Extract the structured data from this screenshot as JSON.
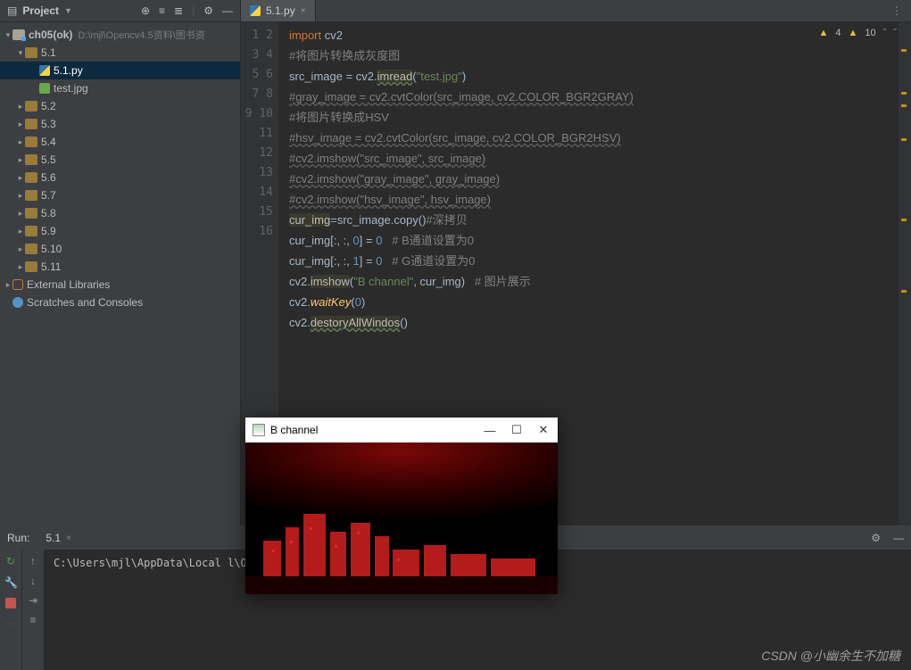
{
  "topbar": {
    "project_label": "Project",
    "icons": [
      "target-icon",
      "collapse-icon",
      "expand-icon",
      "divider",
      "gear-icon",
      "hide-icon"
    ]
  },
  "tab": {
    "label": "5.1.py",
    "close": "×"
  },
  "topmenu": "⋮",
  "tree": {
    "root": {
      "name": "ch05(ok)",
      "path": "D:\\mjl\\Opencv4.5资料\\图书资"
    },
    "folder_open": "5.1",
    "file_py": "5.1.py",
    "file_img": "test.jpg",
    "folders": [
      "5.2",
      "5.3",
      "5.4",
      "5.5",
      "5.6",
      "5.7",
      "5.8",
      "5.9",
      "5.10",
      "5.11"
    ],
    "ext_lib": "External Libraries",
    "scratches": "Scratches and Consoles"
  },
  "warnings": {
    "a": "4",
    "w": "10"
  },
  "code": {
    "l1_kw": "import",
    "l1_mod": " cv2",
    "l2": "#将图片转换成灰度图",
    "l3a": "src_image = cv2.",
    "l3b": "imread",
    "l3c": "(",
    "l3d": "\"test.jpg\"",
    "l3e": ")",
    "l4": "#gray_image = cv2.cvtColor(src_image, cv2.COLOR_BGR2GRAY)",
    "l5": "#将图片转换成HSV",
    "l6": "#hsv_image = cv2.cvtColor(src_image, cv2.COLOR_BGR2HSV)",
    "l7": "#cv2.imshow(\"src_image\", src_image)",
    "l8": "#cv2.imshow(\"gray_image\", gray_image)",
    "l9": "#cv2.imshow(\"hsv_image\", hsv_image)",
    "l10a": "cur_img",
    "l10b": "=src_image.copy()",
    "l10c": "#深拷贝",
    "l11a": "cur_img[:, :, ",
    "l11b": "0",
    "l11c": "] = ",
    "l11d": "0",
    "l11e": "   # B通道设置为0",
    "l12a": "cur_img[:, :, ",
    "l12b": "1",
    "l12c": "] = ",
    "l12d": "0",
    "l12e": "   # G通道设置为0",
    "l13a": "cv2.",
    "l13b": "imshow",
    "l13c": "(",
    "l13d": "\"B channel\"",
    "l13e": ", cur_img)   ",
    "l13f": "# 图片展示",
    "l14a": "cv2.",
    "l14b": "waitKey",
    "l14c": "(",
    "l14d": "0",
    "l14e": ")",
    "l15a": "cv2.",
    "l15b": "destoryAllWindos",
    "l15c": "()"
  },
  "run": {
    "label": "Run:",
    "script": "5.1",
    "close": "×",
    "output": "C:\\Users\\mjl\\AppData\\Local                                                l\\Opencv4.5资料\\图书资料\\源码\\0cd25082-1cfc-11ed-94cb"
  },
  "popup": {
    "title": "B channel",
    "minimize": "—",
    "maximize": "☐",
    "close": "✕"
  },
  "watermark": "CSDN @小幽余生不加糖"
}
